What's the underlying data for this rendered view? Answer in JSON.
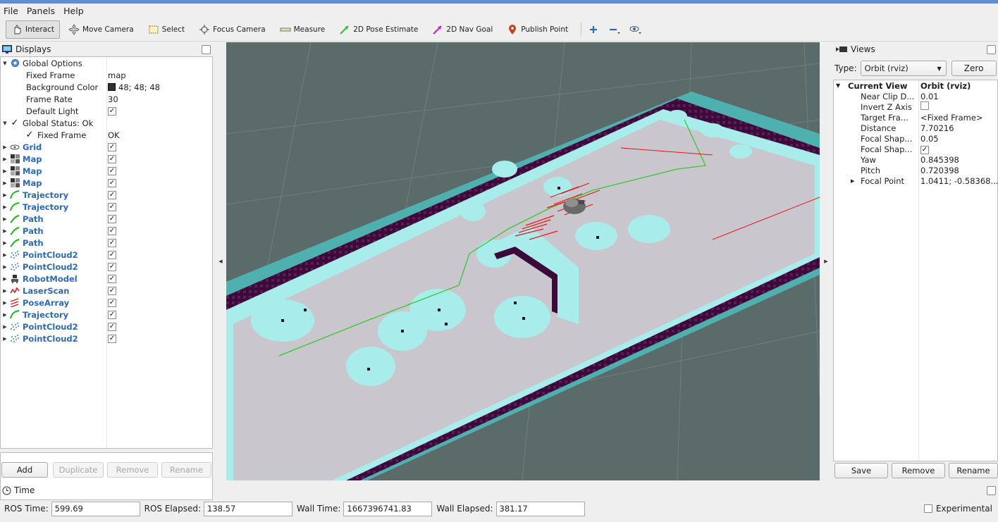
{
  "menu": [
    "File",
    "Panels",
    "Help"
  ],
  "toolbar": {
    "interact": "Interact",
    "move_camera": "Move Camera",
    "select": "Select",
    "focus_camera": "Focus Camera",
    "measure": "Measure",
    "pose_estimate": "2D Pose Estimate",
    "nav_goal": "2D Nav Goal",
    "publish_point": "Publish Point"
  },
  "displays": {
    "title": "Displays",
    "global_options": "Global Options",
    "fixed_frame_label": "Fixed Frame",
    "fixed_frame_value": "map",
    "bg_color_label": "Background Color",
    "bg_color_value": "48; 48; 48",
    "frame_rate_label": "Frame Rate",
    "frame_rate_value": "30",
    "default_light_label": "Default Light",
    "global_status": "Global Status: Ok",
    "status_fixed_frame": "Fixed Frame",
    "status_fixed_frame_value": "OK",
    "items": [
      {
        "label": "Grid",
        "icon": "grid-icon"
      },
      {
        "label": "Map",
        "icon": "map-icon"
      },
      {
        "label": "Map",
        "icon": "map-icon"
      },
      {
        "label": "Map",
        "icon": "map-icon"
      },
      {
        "label": "Trajectory",
        "icon": "trajectory-icon"
      },
      {
        "label": "Trajectory",
        "icon": "trajectory-icon"
      },
      {
        "label": "Path",
        "icon": "path-icon"
      },
      {
        "label": "Path",
        "icon": "path-icon"
      },
      {
        "label": "Path",
        "icon": "path-icon"
      },
      {
        "label": "PointCloud2",
        "icon": "pointcloud-icon"
      },
      {
        "label": "PointCloud2",
        "icon": "pointcloud-icon"
      },
      {
        "label": "RobotModel",
        "icon": "robot-model-icon"
      },
      {
        "label": "LaserScan",
        "icon": "laserscan-icon"
      },
      {
        "label": "PoseArray",
        "icon": "posearray-icon"
      },
      {
        "label": "Trajectory",
        "icon": "trajectory-icon"
      },
      {
        "label": "PointCloud2",
        "icon": "pointcloud-icon"
      },
      {
        "label": "PointCloud2",
        "icon": "pointcloud-icon"
      }
    ],
    "buttons": {
      "add": "Add",
      "duplicate": "Duplicate",
      "remove": "Remove",
      "rename": "Rename"
    }
  },
  "views": {
    "title": "Views",
    "type_label": "Type:",
    "type_value": "Orbit (rviz)",
    "zero": "Zero",
    "current_view": "Current View",
    "current_view_value": "Orbit (rviz)",
    "props": [
      {
        "k": "Near Clip D...",
        "v": "0.01"
      },
      {
        "k": "Invert Z Axis",
        "v": ""
      },
      {
        "k": "Target Fra...",
        "v": "<Fixed Frame>"
      },
      {
        "k": "Distance",
        "v": "7.70216"
      },
      {
        "k": "Focal Shap...",
        "v": "0.05"
      },
      {
        "k": "Focal Shap...",
        "v": ""
      },
      {
        "k": "Yaw",
        "v": "0.845398"
      },
      {
        "k": "Pitch",
        "v": "0.720398"
      },
      {
        "k": "Focal Point",
        "v": "1.0411; -0.58368..."
      }
    ],
    "buttons": {
      "save": "Save",
      "remove": "Remove",
      "rename": "Rename"
    }
  },
  "time": {
    "title": "Time",
    "ros_time_label": "ROS Time:",
    "ros_time": "599.69",
    "ros_elapsed_label": "ROS Elapsed:",
    "ros_elapsed": "138.57",
    "wall_time_label": "Wall Time:",
    "wall_time": "1667396741.83",
    "wall_elapsed_label": "Wall Elapsed:",
    "wall_elapsed": "381.17",
    "experimental": "Experimental"
  },
  "colors": {
    "background": "#5b6b69",
    "floor": "#c9c6cd",
    "inflation": "#a8ecec",
    "teal_border": "#5bc4c4",
    "wall": "#3c0a3a",
    "path": "#2ecc2e",
    "laser": "#ee1111",
    "accent_blue": "#2a6ab8"
  }
}
